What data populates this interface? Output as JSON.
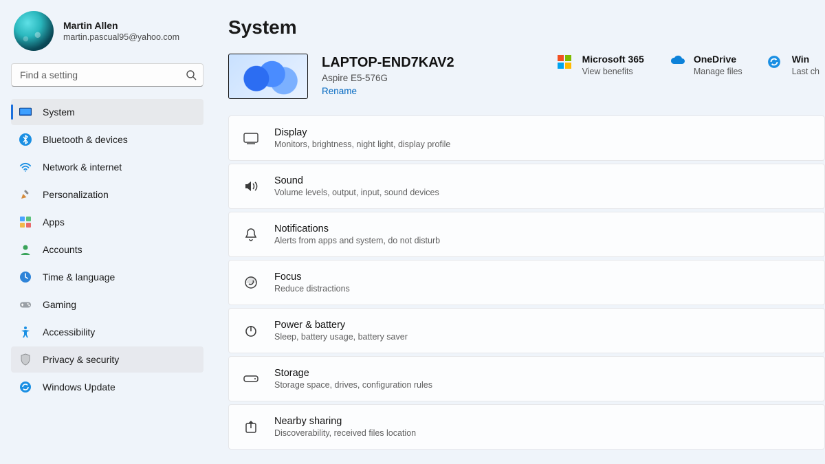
{
  "user": {
    "name": "Martin Allen",
    "email": "martin.pascual95@yahoo.com"
  },
  "search": {
    "placeholder": "Find a setting"
  },
  "sidebar": {
    "items": [
      {
        "icon": "system-icon",
        "label": "System",
        "active": true
      },
      {
        "icon": "bluetooth-icon",
        "label": "Bluetooth & devices",
        "active": false
      },
      {
        "icon": "wifi-icon",
        "label": "Network & internet",
        "active": false
      },
      {
        "icon": "personalization-icon",
        "label": "Personalization",
        "active": false
      },
      {
        "icon": "apps-icon",
        "label": "Apps",
        "active": false
      },
      {
        "icon": "accounts-icon",
        "label": "Accounts",
        "active": false
      },
      {
        "icon": "time-language-icon",
        "label": "Time & language",
        "active": false
      },
      {
        "icon": "gaming-icon",
        "label": "Gaming",
        "active": false
      },
      {
        "icon": "accessibility-icon",
        "label": "Accessibility",
        "active": false
      },
      {
        "icon": "privacy-icon",
        "label": "Privacy & security",
        "active": false,
        "hovered": true
      },
      {
        "icon": "windows-update-icon",
        "label": "Windows Update",
        "active": false
      }
    ]
  },
  "page": {
    "title": "System",
    "device": {
      "name": "LAPTOP-END7KAV2",
      "model": "Aspire E5-576G",
      "rename_label": "Rename"
    },
    "quick_links": [
      {
        "icon": "microsoft-365-icon",
        "title": "Microsoft 365",
        "sub": "View benefits"
      },
      {
        "icon": "onedrive-icon",
        "title": "OneDrive",
        "sub": "Manage files"
      },
      {
        "icon": "windows-update-icon",
        "title": "Win",
        "sub": "Last ch"
      }
    ],
    "cards": [
      {
        "icon": "display-icon",
        "title": "Display",
        "sub": "Monitors, brightness, night light, display profile"
      },
      {
        "icon": "sound-icon",
        "title": "Sound",
        "sub": "Volume levels, output, input, sound devices"
      },
      {
        "icon": "notifications-icon",
        "title": "Notifications",
        "sub": "Alerts from apps and system, do not disturb"
      },
      {
        "icon": "focus-icon",
        "title": "Focus",
        "sub": "Reduce distractions"
      },
      {
        "icon": "power-icon",
        "title": "Power & battery",
        "sub": "Sleep, battery usage, battery saver"
      },
      {
        "icon": "storage-icon",
        "title": "Storage",
        "sub": "Storage space, drives, configuration rules"
      },
      {
        "icon": "nearby-share-icon",
        "title": "Nearby sharing",
        "sub": "Discoverability, received files location"
      }
    ]
  },
  "colors": {
    "accent": "#1a6fdc",
    "link": "#0067c0"
  }
}
